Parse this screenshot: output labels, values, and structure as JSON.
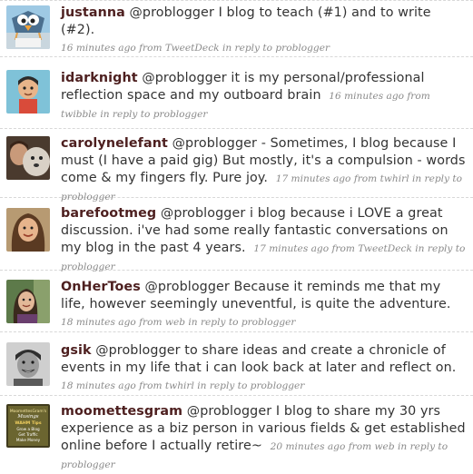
{
  "tweets": [
    {
      "user": "justanna",
      "mention": "@problogger",
      "text": "I blog to teach (#1) and to write (#2).",
      "time": "16 minutes ago",
      "source": "from TweetDeck",
      "reply": "in reply to problogger",
      "avatar_icon": "cartoon-bird-wtf-icon"
    },
    {
      "user": "idarknight",
      "mention": "@problogger",
      "text": "it is my personal/professional reflection space and my outboard brain",
      "time": "16 minutes ago",
      "source": "from twibble",
      "reply": "in reply to problogger",
      "avatar_icon": "cartoon-man-icon"
    },
    {
      "user": "carolynelefant",
      "mention": "@problogger",
      "text": "- Sometimes, I blog because I must (I have a paid gig) But mostly, it's a compulsion - words come & my fingers fly. Pure joy.",
      "time": "17 minutes ago",
      "source": "from twhirl",
      "reply": "in reply to problogger",
      "avatar_icon": "woman-and-dog-photo-icon"
    },
    {
      "user": "barefootmeg",
      "mention": "@problogger",
      "text": "i blog because i LOVE a great discussion. i've had some really fantastic conversations on my blog in the past 4 years.",
      "time": "17 minutes ago",
      "source": "from TweetDeck",
      "reply": "in reply to problogger",
      "avatar_icon": "woman-portrait-icon"
    },
    {
      "user": "OnHerToes",
      "mention": "@problogger",
      "text": "Because it reminds me that my life, however seemingly uneventful, is quite the adventure.",
      "time": "18 minutes ago",
      "source": "from web",
      "reply": "in reply to problogger",
      "avatar_icon": "woman-outdoors-photo-icon"
    },
    {
      "user": "gsik",
      "mention": "@problogger",
      "text": "to share ideas and create a chronicle of events in my life that i can look back at later and reflect on.",
      "time": "18 minutes ago",
      "source": "from twhirl",
      "reply": "in reply to problogger",
      "avatar_icon": "smiling-man-bw-photo-icon"
    },
    {
      "user": "moomettesgram",
      "mention": "@problogger",
      "text": "I blog to share my 30 yrs experience as a biz person in various fields & get established online before I actually retire~",
      "time": "20 minutes ago",
      "source": "from web",
      "reply": "in reply to problogger",
      "avatar_icon": "blog-badge-icon",
      "avatar_text": [
        "MoomettesGram's",
        "Musings",
        "WAHM Tips",
        "Grow a Blog",
        "Get Traffic",
        "Make Money"
      ]
    }
  ],
  "colors": {
    "screen_name": "#4d1f1f",
    "text": "#333333",
    "meta": "#8a8a8a",
    "divider": "#d8d8d8"
  }
}
